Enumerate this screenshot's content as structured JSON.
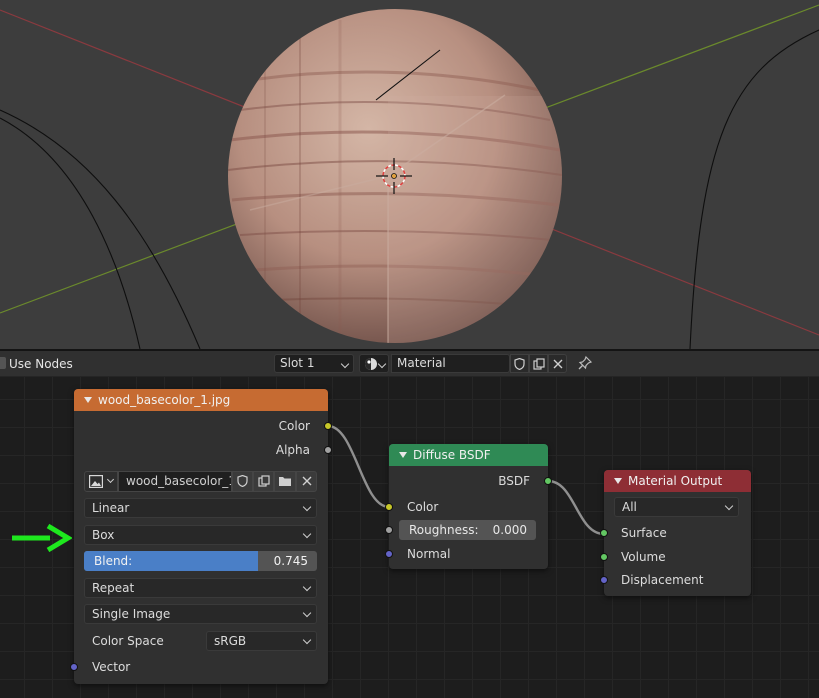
{
  "header": {
    "use_nodes_label": "Use Nodes",
    "slot": "Slot 1",
    "material_name": "Material"
  },
  "image_node": {
    "title": "wood_basecolor_1.jpg",
    "outputs": [
      "Color",
      "Alpha"
    ],
    "image_name": "wood_basecolor_1...",
    "interpolation": "Linear",
    "projection": "Box",
    "blend_label": "Blend:",
    "blend_value": "0.745",
    "blend_fraction": 0.745,
    "extension": "Repeat",
    "source": "Single Image",
    "color_space_label": "Color Space",
    "color_space": "sRGB",
    "input_vector": "Vector",
    "header_color": "#c66b32"
  },
  "diffuse_node": {
    "title": "Diffuse BSDF",
    "output": "BSDF",
    "input_color": "Color",
    "roughness_label": "Roughness:",
    "roughness_value": "0.000",
    "input_normal": "Normal",
    "header_color": "#2f8a55"
  },
  "output_node": {
    "title": "Material Output",
    "target": "All",
    "inputs": [
      "Surface",
      "Volume",
      "Displacement"
    ],
    "header_color": "#8e2e35"
  },
  "annotation": {
    "arrow_color": "#1ee81e",
    "points_to": "projection"
  }
}
